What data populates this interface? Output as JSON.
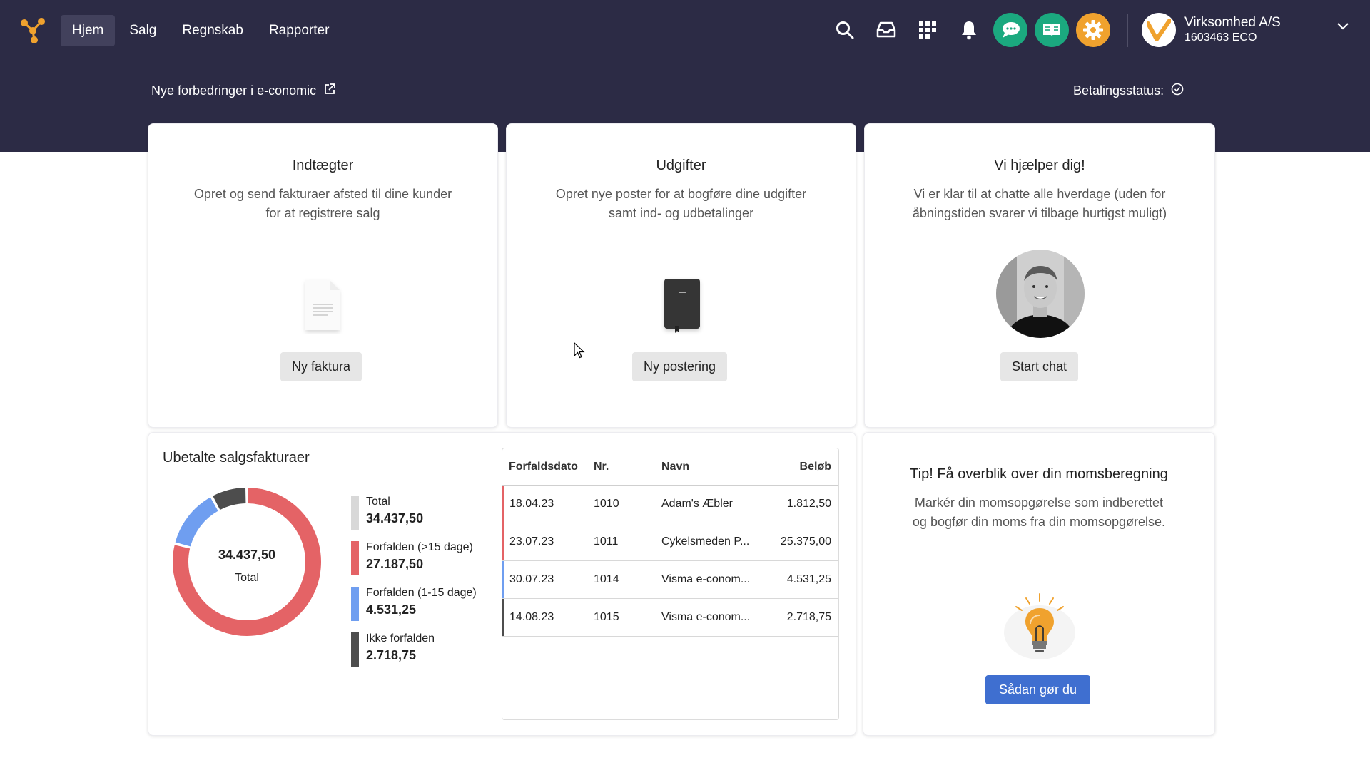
{
  "nav": {
    "items": [
      "Hjem",
      "Salg",
      "Regnskab",
      "Rapporter"
    ],
    "active": "Hjem"
  },
  "icons": {
    "search": "search-icon",
    "inbox": "inbox-icon",
    "apps": "apps-grid-icon",
    "notifications": "bell-icon",
    "chat": "chat-icon",
    "help": "book-icon",
    "settings": "gear-icon"
  },
  "colors": {
    "topbar": "#2c2b45",
    "chat": "#1ba97f",
    "help": "#1ba97f",
    "settings": "#f0a22e",
    "overdue_long": "#e46366",
    "overdue_short": "#6f9ef0",
    "not_overdue": "#4d4d4d",
    "total": "#d8d8d8",
    "primary_button": "#3f6fd0"
  },
  "company": {
    "name": "Virksomhed A/S",
    "id": "1603463 ECO"
  },
  "banner": {
    "news_link": "Nye forbedringer i e-conomic",
    "payment_status": "Betalingsstatus:"
  },
  "cards": {
    "income": {
      "title": "Indtægter",
      "desc_line1": "Opret og send fakturaer afsted til dine kunder",
      "desc_line2": "for at registrere salg",
      "button": "Ny faktura"
    },
    "expenses": {
      "title": "Udgifter",
      "desc_line1": "Opret nye poster for at bogføre dine udgifter",
      "desc_line2": "samt ind- og udbetalinger",
      "button": "Ny postering"
    },
    "help": {
      "title": "Vi hjælper dig!",
      "desc_line1": "Vi er klar til at chatte alle hverdage (uden for",
      "desc_line2": "åbningstiden svarer vi tilbage hurtigst muligt)",
      "button": "Start chat"
    },
    "tip": {
      "title": "Tip! Få overblik over din momsberegning",
      "desc_line1": "Markér din momsopgørelse som indberettet",
      "desc_line2": "og bogfør din moms fra din momsopgørelse.",
      "button": "Sådan gør du"
    }
  },
  "unpaid": {
    "title": "Ubetalte salgsfakturaer",
    "donut_value": "34.437,50",
    "donut_label": "Total",
    "legend": [
      {
        "label": "Total",
        "value": "34.437,50"
      },
      {
        "label": "Forfalden (>15 dage)",
        "value": "27.187,50"
      },
      {
        "label": "Forfalden (1-15 dage)",
        "value": "4.531,25"
      },
      {
        "label": "Ikke forfalden",
        "value": "2.718,75"
      }
    ],
    "table": {
      "headers": [
        "Forfaldsdato",
        "Nr.",
        "Navn",
        "Beløb"
      ],
      "rows": [
        {
          "date": "18.04.23",
          "nr": "1010",
          "name": "Adam's Æbler",
          "amount": "1.812,50"
        },
        {
          "date": "23.07.23",
          "nr": "1011",
          "name": "Cykelsmeden P...",
          "amount": "25.375,00"
        },
        {
          "date": "30.07.23",
          "nr": "1014",
          "name": "Visma e-conom...",
          "amount": "4.531,25"
        },
        {
          "date": "14.08.23",
          "nr": "1015",
          "name": "Visma e-conom...",
          "amount": "2.718,75"
        }
      ]
    }
  },
  "chart_data": {
    "type": "pie",
    "categories": [
      "Forfalden (>15 dage)",
      "Forfalden (1-15 dage)",
      "Ikke forfalden"
    ],
    "values": [
      27187.5,
      4531.25,
      2718.75
    ],
    "title": "Ubetalte salgsfakturaer"
  }
}
